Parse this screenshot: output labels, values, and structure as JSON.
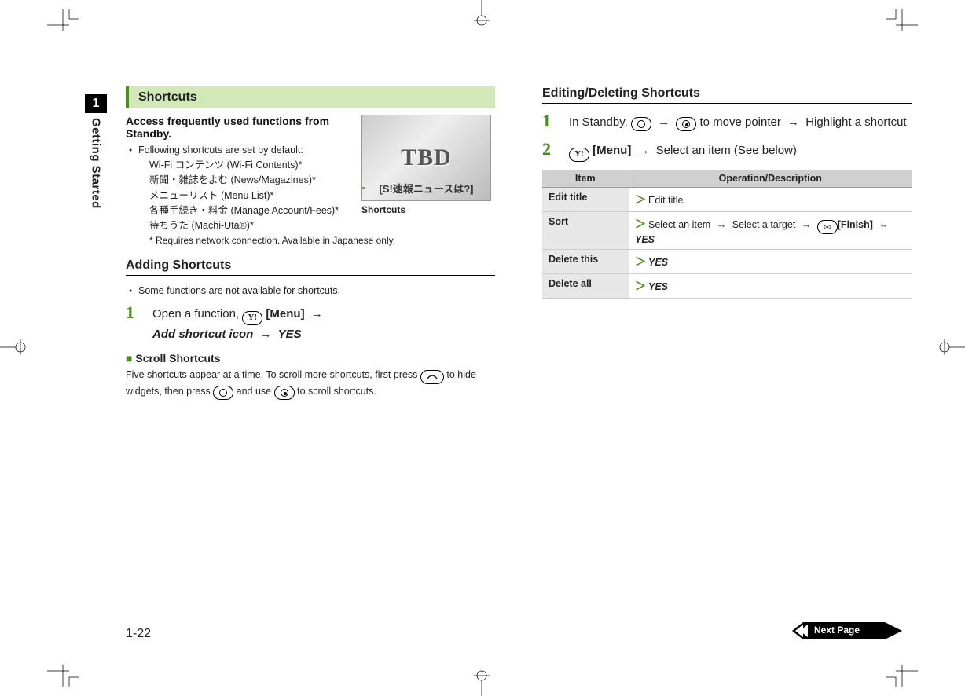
{
  "chapter": {
    "number": "1",
    "name": "Getting Started"
  },
  "left": {
    "section_title": "Shortcuts",
    "lead": "Access frequently used functions from Standby.",
    "bullet_intro": "Following shortcuts are set by default:",
    "defaults": [
      "Wi-Fi コンテンツ (Wi-Fi Contents)*",
      "新聞・雑誌をよむ (News/Magazines)*",
      "メニューリスト (Menu List)*",
      "各種手続き・料金 (Manage Account/Fees)*",
      "待ちうた (Machi-Uta®)*"
    ],
    "footnote": "* Requires network connection. Available in Japanese only.",
    "screenshot_caption": "Shortcuts",
    "screenshot_placeholder": "TBD",
    "screenshot_overlay": "[S!速報ニュースは?]",
    "adding_h": "Adding Shortcuts",
    "adding_note": "Some functions are not available for shortcuts.",
    "step1_a": "Open a function, ",
    "step1_menu": "[Menu]",
    "step1_b": "Add shortcut icon",
    "step1_c": "YES",
    "scroll_h": "Scroll Shortcuts",
    "scroll_body_a": "Five shortcuts appear at a time. To scroll more shortcuts, first press ",
    "scroll_body_b": " to hide widgets, then press ",
    "scroll_body_c": " and use ",
    "scroll_body_d": " to scroll shortcuts."
  },
  "right": {
    "h": "Editing/Deleting Shortcuts",
    "step1_a": "In Standby, ",
    "step1_b": " to move pointer ",
    "step1_c": " Highlight a shortcut",
    "step2_menu": "[Menu]",
    "step2_b": " Select an item (See below)",
    "table": {
      "head_item": "Item",
      "head_op": "Operation/Description",
      "rows": [
        {
          "item": "Edit title",
          "op_plain": "Edit title"
        },
        {
          "item": "Sort",
          "op_sort_a": "Select an item",
          "op_sort_b": "Select a target",
          "op_sort_finish": "[Finish]",
          "op_sort_yes": "YES"
        },
        {
          "item": "Delete this",
          "op_yes": "YES"
        },
        {
          "item": "Delete all",
          "op_yes": "YES"
        }
      ]
    }
  },
  "footer": {
    "page": "1-22",
    "next": "Next Page"
  }
}
